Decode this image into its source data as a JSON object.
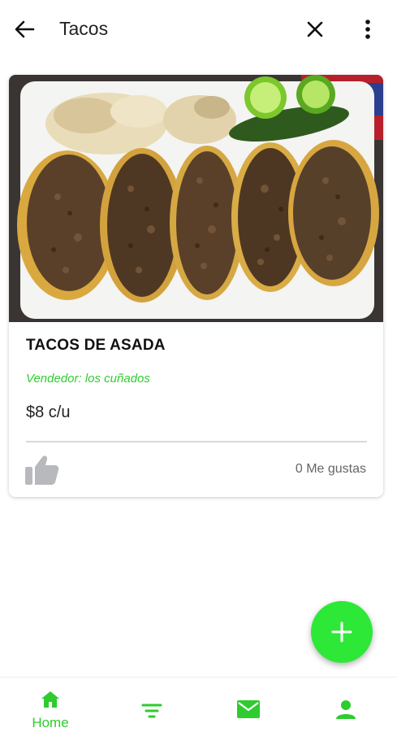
{
  "header": {
    "title": "Tacos",
    "back_icon": "arrow-left-icon",
    "close_icon": "close-icon",
    "menu_icon": "more-vert-icon"
  },
  "post": {
    "name": "TACOS DE ASADA",
    "vendor": "Vendedor: los cuñados",
    "price": "$8 c/u",
    "likes": "0 Me gustas",
    "like_icon": "thumbs-up-icon",
    "image_icon": "tacos-photo"
  },
  "fab": {
    "icon": "plus-icon"
  },
  "bottom_nav": {
    "home_label": "Home",
    "items": [
      "home-icon",
      "filter-icon",
      "mail-icon",
      "person-icon"
    ]
  },
  "colors": {
    "accent": "#2ee838",
    "vendor_text": "#33cc33",
    "nav_active": "#2ecc2e",
    "icon_grey": "#b7b9bd"
  }
}
